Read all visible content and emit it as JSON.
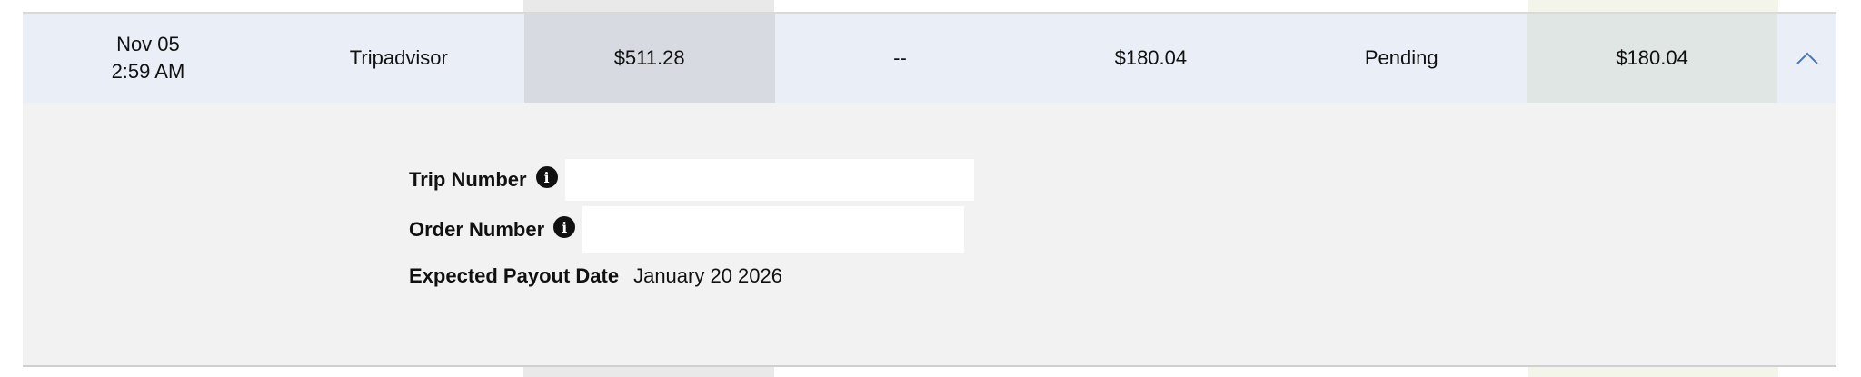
{
  "row": {
    "date": "Nov 05",
    "time": "2:59 AM",
    "provider": "Tripadvisor",
    "purchase_amount": "$511.28",
    "adjustment": "--",
    "commission": "$180.04",
    "status": "Pending",
    "payout": "$180.04",
    "toggle_icon": "chevron-up-icon"
  },
  "details": {
    "trip_number_label": "Trip Number",
    "trip_number_value": "",
    "order_number_label": "Order Number",
    "order_number_value": "",
    "expected_payout_label": "Expected Payout Date",
    "expected_payout_value": "January 20 2026",
    "info_icon": "info-icon"
  },
  "colors": {
    "row_background": "#eaeff7",
    "highlight_column": "#d7dbe1",
    "payout_column": "#dfe6e4",
    "details_background": "#f2f2f2",
    "chevron": "#4a78b5"
  }
}
